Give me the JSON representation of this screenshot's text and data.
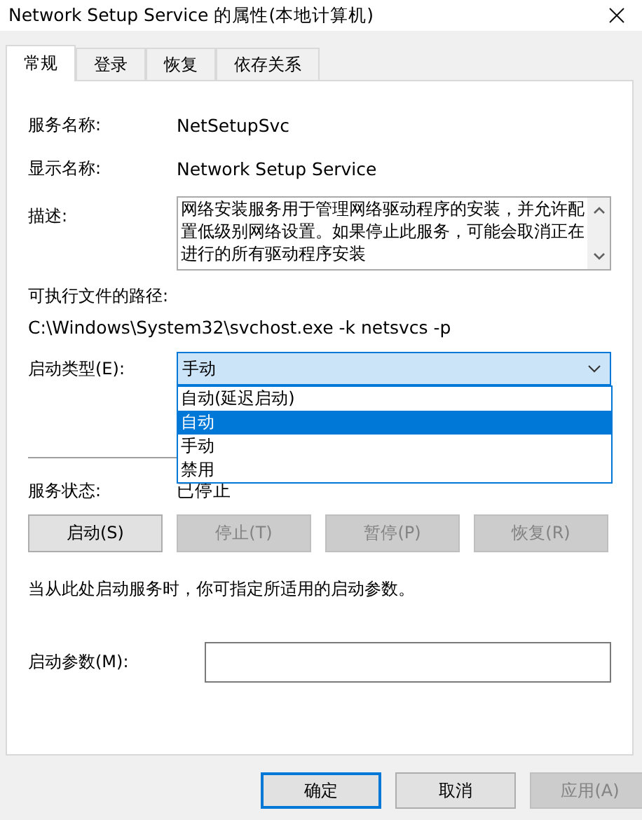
{
  "window": {
    "title": "Network Setup Service 的属性(本地计算机)"
  },
  "tabs": [
    {
      "label": "常规",
      "selected": true
    },
    {
      "label": "登录",
      "selected": false
    },
    {
      "label": "恢复",
      "selected": false
    },
    {
      "label": "依存关系",
      "selected": false
    }
  ],
  "fields": [
    {
      "label": "服务名称:",
      "value": "NetSetupSvc"
    },
    {
      "label": "显示名称:",
      "value": "Network Setup Service"
    }
  ],
  "description": {
    "label": "描述:",
    "value": "网络安装服务用于管理网络驱动程序的安装，并允许配置低级别网络设置。如果停止此服务，可能会取消正在进行的所有驱动程序安装"
  },
  "path": {
    "label": "可执行文件的路径:",
    "value": "C:\\Windows\\System32\\svchost.exe -k netsvcs -p"
  },
  "startup_type": {
    "label": "启动类型(E):",
    "value": "手动",
    "expanded": true,
    "options": [
      {
        "label": "自动(延迟启动)",
        "highlighted": false
      },
      {
        "label": "自动",
        "highlighted": true
      },
      {
        "label": "手动",
        "highlighted": false
      },
      {
        "label": "禁用",
        "highlighted": false
      }
    ]
  },
  "status": {
    "label": "服务状态:",
    "value": "已停止"
  },
  "service_buttons": [
    {
      "label": "启动(S)",
      "disabled": false
    },
    {
      "label": "停止(T)",
      "disabled": true
    },
    {
      "label": "暂停(P)",
      "disabled": true
    },
    {
      "label": "恢复(R)",
      "disabled": true
    }
  ],
  "hint": "当从此处启动服务时，你可指定所适用的启动参数。",
  "parameters": {
    "label": "启动参数(M):"
  },
  "dialog_buttons": [
    {
      "label": "确定",
      "disabled": false
    },
    {
      "label": "取消",
      "disabled": false
    },
    {
      "label": "应用(A)",
      "disabled": true
    }
  ]
}
